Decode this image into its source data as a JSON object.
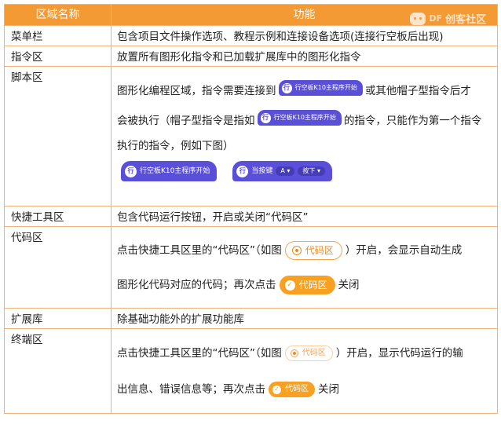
{
  "header": {
    "col1": "区域名称",
    "col2": "功能"
  },
  "logo": {
    "brand": "DF",
    "text": "创客社区"
  },
  "rows": [
    {
      "name": "菜单栏",
      "desc": "包含项目文件操作选项、教程示例和连接设备选项(连接行空板后出现)"
    },
    {
      "name": "指令区",
      "desc": "放置所有图形化指令和已加载扩展库中的图形化指令"
    },
    {
      "name": "脚本区",
      "line1_a": "图形化编程区域，指令需要连接到",
      "line1_b": "或其他帽子型指令后才",
      "line2_a": "会被执行（帽子型指令是指如",
      "line2_b": "的指令，只能作为第一个指令",
      "line3": "执行的指令，例如下图）",
      "hat_label": "行空板K10主程序开始",
      "hat_icon": "行",
      "block2_label": "当按键",
      "block2_key": "A",
      "block2_state": "按下",
      "dropdown_icon": "caret-down-icon"
    },
    {
      "name": "快捷工具区",
      "desc": "包含代码运行按钮，开启或关闭“代码区”"
    },
    {
      "name": "代码区",
      "line1_a": "点击快捷工具区里的“代码区”（如图",
      "line1_b": "）开启，会显示自动生成",
      "line2_a": "图形化代码对应的代码；再次点击",
      "line2_b": "关闭",
      "btn_label": "代码区"
    },
    {
      "name": "扩展库",
      "desc": "除基础功能外的扩展功能库"
    },
    {
      "name": "终端区",
      "line1_a": "点击快捷工具区里的“代码区”（如图",
      "line1_b": "）开启，显示代码运行的输",
      "line2_a": "出信息、错误信息等；再次点击",
      "line2_b": "关闭",
      "btn_label": "代码区"
    }
  ],
  "colors": {
    "header_bg": "#f39a34",
    "border": "#f0b37a",
    "block_purple": "#5a4fd8",
    "button_orange": "#f7a021"
  }
}
